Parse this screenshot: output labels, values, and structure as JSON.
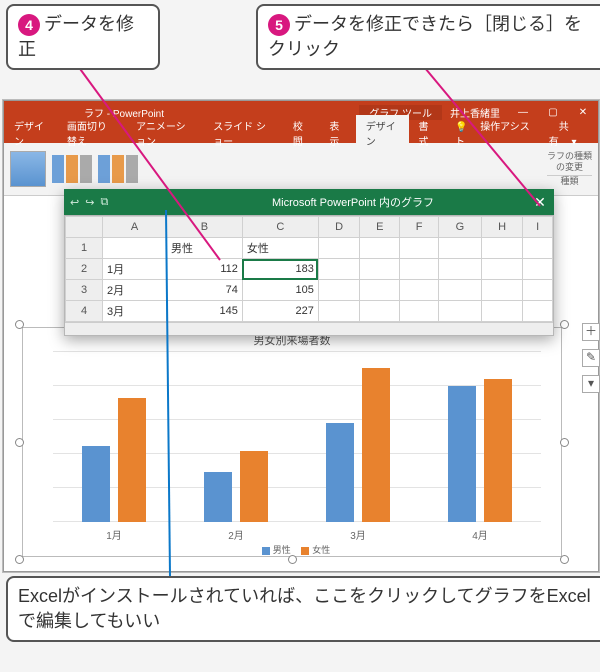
{
  "callouts": {
    "c4_num": "4",
    "c4_text": "データを修正",
    "c5_num": "5",
    "c5_text": "データを修正できたら［閉じる］をクリック",
    "bottom_text": "Excelがインストールされていれば、ここをクリックしてグラフをExcelで編集してもいい"
  },
  "app": {
    "title_suffix": "ラフ - PowerPoint",
    "tool_tab": "グラフ ツール",
    "user": "井上香緒里",
    "tabs": {
      "design": "デザイン",
      "transition": "画面切り替え",
      "anim": "アニメーション",
      "slideshow": "スライド ショー",
      "review": "校閲",
      "view": "表示",
      "cdesign": "デザイン",
      "format": "書式"
    },
    "assist": "操作アシスト",
    "share": "共有",
    "ribbon_right1": "ラフの種類",
    "ribbon_right2": "の変更",
    "ribbon_right3": "種類"
  },
  "datasheet": {
    "title": "Microsoft PowerPoint 内のグラフ",
    "cols": [
      "",
      "A",
      "B",
      "C",
      "D",
      "E",
      "F",
      "G",
      "H",
      "I"
    ],
    "head": {
      "b": "男性",
      "c": "女性"
    },
    "rows": [
      {
        "n": "1",
        "a": "",
        "b": "男性",
        "c": "女性"
      },
      {
        "n": "2",
        "a": "1月",
        "b": "112",
        "c": "183"
      },
      {
        "n": "3",
        "a": "2月",
        "b": "74",
        "c": "105"
      },
      {
        "n": "4",
        "a": "3月",
        "b": "145",
        "c": "227"
      }
    ],
    "icons": {
      "back": "↩",
      "fwd": "↪",
      "excel": "⧉",
      "close": "✕"
    }
  },
  "chart_data": {
    "type": "bar",
    "title": "男女別来場者数",
    "categories": [
      "1月",
      "2月",
      "3月",
      "4月"
    ],
    "series": [
      {
        "name": "男性",
        "values": [
          112,
          74,
          145,
          200
        ]
      },
      {
        "name": "女性",
        "values": [
          183,
          105,
          227,
          210
        ]
      }
    ],
    "ylim": [
      0,
      250
    ],
    "legend": {
      "m": "男性",
      "f": "女性"
    }
  },
  "side_tools": {
    "plus": "＋",
    "brush": "✎",
    "filter": "▾"
  }
}
